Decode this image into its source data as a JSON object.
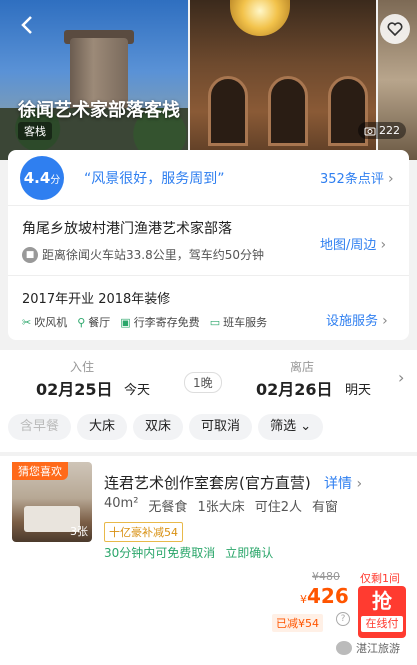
{
  "hero": {
    "title": "徐闻艺术家部落客栈",
    "type_tag": "客栈",
    "photo_count": "222"
  },
  "review": {
    "score": "4.4",
    "score_unit": "分",
    "quote": "“风景很好，服务周到”",
    "count_text": "352条点评"
  },
  "location": {
    "address": "角尾乡放坡村港门渔港艺术家部落",
    "distance": "距离徐闻火车站33.8公里，驾车约50分钟",
    "map_link": "地图/周边"
  },
  "facilities": {
    "year_text": "2017年开业  2018年装修",
    "items": [
      {
        "label": "吹风机",
        "icon": "hairdryer-icon"
      },
      {
        "label": "餐厅",
        "icon": "restaurant-icon"
      },
      {
        "label": "行李寄存免费",
        "icon": "luggage-icon"
      },
      {
        "label": "班车服务",
        "icon": "shuttle-icon"
      }
    ],
    "service_link": "设施服务"
  },
  "dates": {
    "checkin_caption": "入住",
    "checkin_date": "02月25日",
    "checkin_day": "今天",
    "nights": "1晚",
    "checkout_caption": "离店",
    "checkout_date": "02月26日",
    "checkout_day": "明天"
  },
  "filters": [
    "含早餐",
    "大床",
    "双床",
    "可取消",
    "筛选"
  ],
  "room": {
    "badge": "猜您喜欢",
    "image_count": "3张",
    "name": "连君艺术创作室套房(官方直营)",
    "detail_link": "详情",
    "attrs": [
      "40m²",
      "无餐食",
      "1张大床",
      "可住2人",
      "有窗"
    ],
    "promo": "十亿豪补减54",
    "cancel": "30分钟内可免费取消",
    "confirm": "立即确认",
    "original_price": "¥480",
    "currency": "¥",
    "price": "426",
    "rooms_left": "仅剩1间",
    "discount": "已减¥54",
    "grab_label": "抢",
    "grab_sub": "在线付"
  },
  "watermark": "湛江旅游"
}
